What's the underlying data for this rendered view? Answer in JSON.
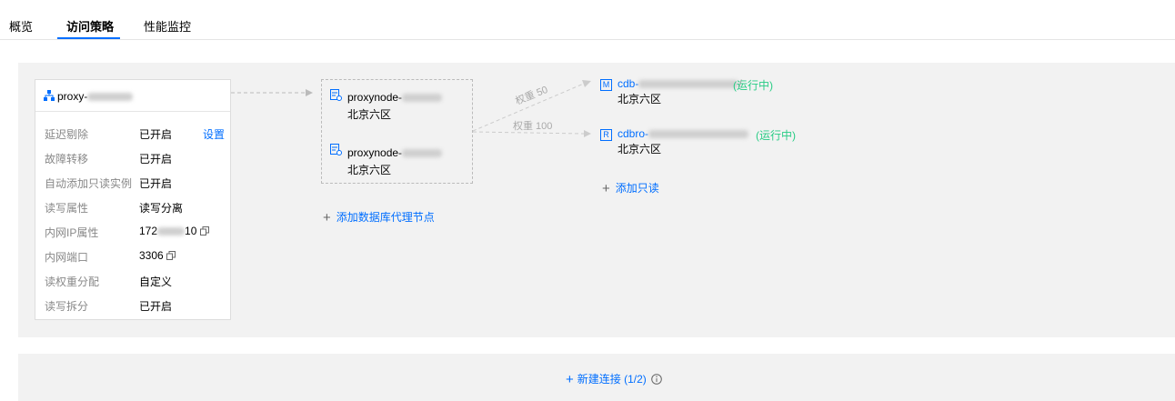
{
  "tabs": [
    {
      "label": "概览"
    },
    {
      "label": "访问策略"
    },
    {
      "label": "性能监控"
    }
  ],
  "proxy": {
    "name_prefix": "proxy-",
    "rows": [
      {
        "label": "延迟剔除",
        "value": "已开启",
        "action": "设置"
      },
      {
        "label": "故障转移",
        "value": "已开启"
      },
      {
        "label": "自动添加只读实例",
        "value": "已开启"
      },
      {
        "label": "读写属性",
        "value": "读写分离"
      },
      {
        "label": "内网IP属性",
        "value_prefix": "172",
        "value_suffix": "10"
      },
      {
        "label": "内网端口",
        "value": "3306"
      },
      {
        "label": "读权重分配",
        "value": "自定义"
      },
      {
        "label": "读写拆分",
        "value": "已开启"
      }
    ]
  },
  "nodes": [
    {
      "name_prefix": "proxynode-",
      "region": "北京六区"
    },
    {
      "name_prefix": "proxynode-",
      "region": "北京六区"
    }
  ],
  "add_node_label": "添加数据库代理节点",
  "weights": [
    {
      "label": "权重 50"
    },
    {
      "label": "权重 100"
    }
  ],
  "instances": [
    {
      "badge": "M",
      "name_prefix": "cdb-",
      "tail": "/",
      "status": "(运行中)",
      "region": "北京六区"
    },
    {
      "badge": "R",
      "name_prefix": "cdbro-",
      "status": "(运行中)",
      "region": "北京六区"
    }
  ],
  "add_readonly_label": "添加只读",
  "new_connection_label": "新建连接 (1/2)",
  "icons": {
    "proxy": "topology-icon",
    "node": "server-node-icon",
    "copy": "copy-icon",
    "info": "info-icon",
    "plus": "plus-icon"
  },
  "colors": {
    "accent": "#006eff",
    "running": "#29cc85",
    "panel": "#f2f2f2"
  }
}
